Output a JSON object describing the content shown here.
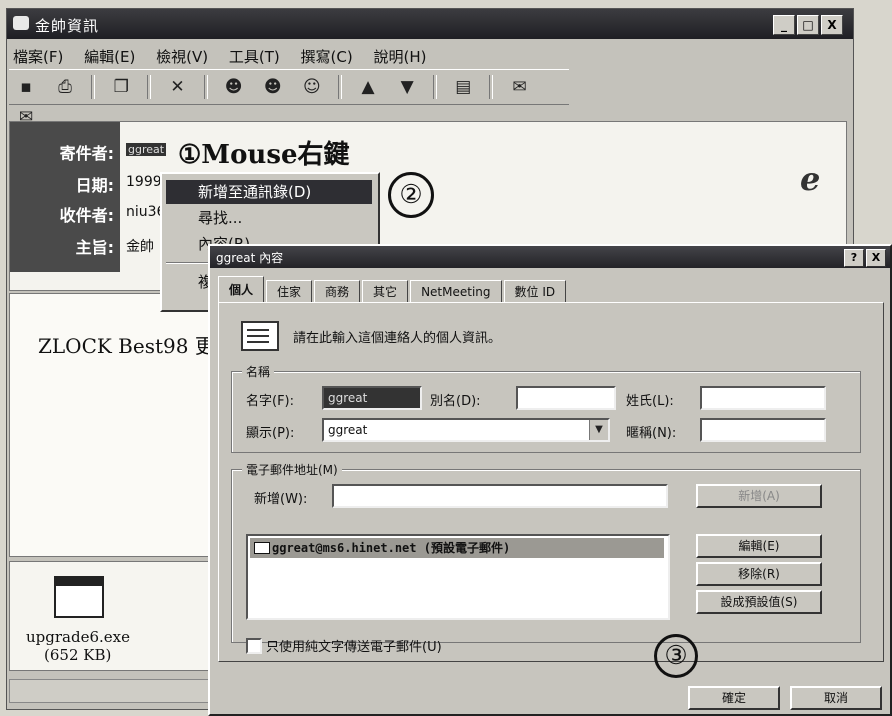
{
  "window": {
    "title": "金帥資訊",
    "controls": [
      "_",
      "□",
      "X"
    ]
  },
  "menu": [
    "檔案(F)",
    "編輯(E)",
    "檢視(V)",
    "工具(T)",
    "撰寫(C)",
    "說明(H)"
  ],
  "header": {
    "from_label": "寄件者:",
    "from_value": "ggreat",
    "date_label": "日期:",
    "date_value": "1999",
    "to_label": "收件者:",
    "to_value": "niu36",
    "subject_label": "主旨:",
    "subject_value": "金帥"
  },
  "body": {
    "text": "ZLOCK Best98 更"
  },
  "attachment": {
    "name": "upgrade6.exe",
    "size": "(652 KB)"
  },
  "annotations": {
    "step1": "①Mouse右鍵",
    "step2": "②",
    "step3": "③"
  },
  "context_menu": {
    "items": [
      "新增至通訊錄(D)",
      "尋找...",
      "內容(R)",
      "複"
    ]
  },
  "dialog": {
    "title": "ggreat 內容",
    "help_btn": "?",
    "close_btn": "X",
    "tabs": [
      "個人",
      "住家",
      "商務",
      "其它",
      "NetMeeting",
      "數位 ID"
    ],
    "intro": "請在此輸入這個連絡人的個人資訊。",
    "name_group": {
      "title": "名稱",
      "first_label": "名字(F):",
      "first_value": "ggreat",
      "middle_label": "別名(D):",
      "middle_value": "",
      "last_label": "姓氏(L):",
      "last_value": "",
      "display_label": "顯示(P):",
      "display_value": "ggreat",
      "nickname_label": "暱稱(N):",
      "nickname_value": ""
    },
    "email_group": {
      "title": "電子郵件地址(M)",
      "add_label": "新增(W):",
      "add_value": "",
      "add_button": "新增(A)",
      "entry": "ggreat@ms6.hinet.net (預設電子郵件)",
      "edit_button": "編輯(E)",
      "remove_button": "移除(R)",
      "default_button": "設成預設值(S)"
    },
    "plain_text_label": "只使用純文字傳送電子郵件(U)",
    "ok_button": "確定",
    "cancel_button": "取消"
  }
}
